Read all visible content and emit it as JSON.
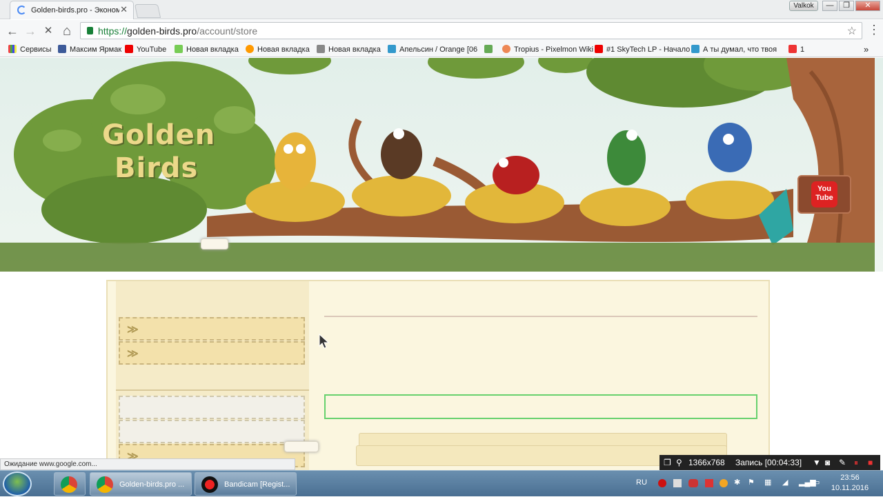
{
  "browser": {
    "tab_title": "Golden-birds.pro - Эконом",
    "tab_close": "✕",
    "user_badge": "Valkok",
    "win_min": "—",
    "win_restore": "❐",
    "win_close": "✕",
    "back_icon": "←",
    "forward_icon": "→",
    "reload_icon": "✕",
    "home_icon": "⌂",
    "url_scheme": "https://",
    "url_host": "golden-birds.pro",
    "url_path": "/account/store",
    "star_icon": "☆",
    "menu_icon": "⋮"
  },
  "bookmarks": [
    {
      "label": "Сервисы",
      "icon_color": "#e44"
    },
    {
      "label": "Максим Ярмак",
      "icon_color": "#3d5a99"
    },
    {
      "label": "YouTube",
      "icon_color": "#e00"
    },
    {
      "label": "Новая вкладка",
      "icon_color": "#7c5"
    },
    {
      "label": "Новая вкладка",
      "icon_color": "#f90"
    },
    {
      "label": "Новая вкладка",
      "icon_color": "#888"
    },
    {
      "label": "Апельсин / Orange [06",
      "icon_color": "#39c"
    },
    {
      "label": "",
      "icon_color": "#6a5"
    },
    {
      "label": "Tropius - Pixelmon Wiki",
      "icon_color": "#e85"
    },
    {
      "label": "#1 SkyTech LP - Начало",
      "icon_color": "#e00"
    },
    {
      "label": "А ты думал, что твоя",
      "icon_color": "#39c"
    },
    {
      "label": "1",
      "icon_color": "#e33"
    }
  ],
  "bookmarks_more": "»",
  "site": {
    "logo_line1": "Golden",
    "logo_line2": "Birds",
    "youtube_label": "You Tube",
    "sidebar_chevron": "≫"
  },
  "status_text": "Ожидание www.google.com...",
  "bandicam": {
    "resolution": "1366x768",
    "recording": "Запись [00:04:33]"
  },
  "taskbar": {
    "items": [
      {
        "label": ""
      },
      {
        "label": "Golden-birds.pro ..."
      },
      {
        "label": "Bandicam [Regist..."
      }
    ],
    "language": "RU",
    "time": "23:56",
    "date": "10.11.2016"
  },
  "colors": {
    "accent_green": "#6d8e43",
    "panel_bg": "#fbf6df",
    "field_border": "#66d16d"
  }
}
